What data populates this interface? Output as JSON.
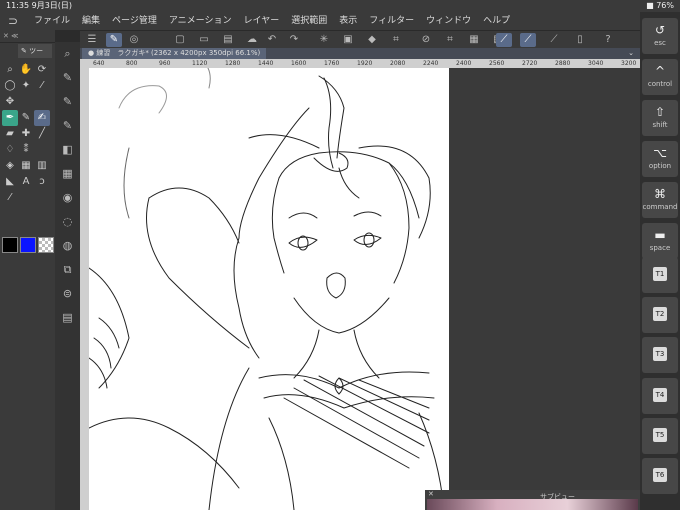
{
  "status": {
    "time": "11:35",
    "date": "9月3日(日)",
    "right": "■ 76%"
  },
  "menu": {
    "logo_icon": "clip-studio-logo",
    "items": [
      "ファイル",
      "編集",
      "ページ管理",
      "アニメーション",
      "レイヤー",
      "選択範囲",
      "表示",
      "フィルター",
      "ウィンドウ",
      "ヘルプ"
    ]
  },
  "leftpanel": {
    "header": "✕  ≪",
    "pen_label": "ツー"
  },
  "tabbar": {
    "title": "● 練習　ラクガキ* (2362 x 4200px 350dpi 66.1%)"
  },
  "ruler": {
    "labels": [
      "640",
      "800",
      "960",
      "1120",
      "1280",
      "1440",
      "1600",
      "1760",
      "1920",
      "2080",
      "2240",
      "2400",
      "2560",
      "2720",
      "2880",
      "3040",
      "3200"
    ]
  },
  "subview": {
    "title": "サブビュー"
  },
  "right_keys": [
    {
      "glyph": "↺",
      "label": "esc"
    },
    {
      "glyph": "^",
      "label": "control"
    },
    {
      "glyph": "⇧",
      "label": "shift"
    },
    {
      "glyph": "⌥",
      "label": "option"
    },
    {
      "glyph": "⌘",
      "label": "command"
    },
    {
      "glyph": "▬",
      "label": "space"
    }
  ],
  "tkeys": [
    "T1",
    "T2",
    "T3",
    "T4",
    "T5",
    "T6"
  ],
  "colors": {
    "main": "#000000",
    "sub": "#0a14ff",
    "accent": "#3aa58a"
  }
}
